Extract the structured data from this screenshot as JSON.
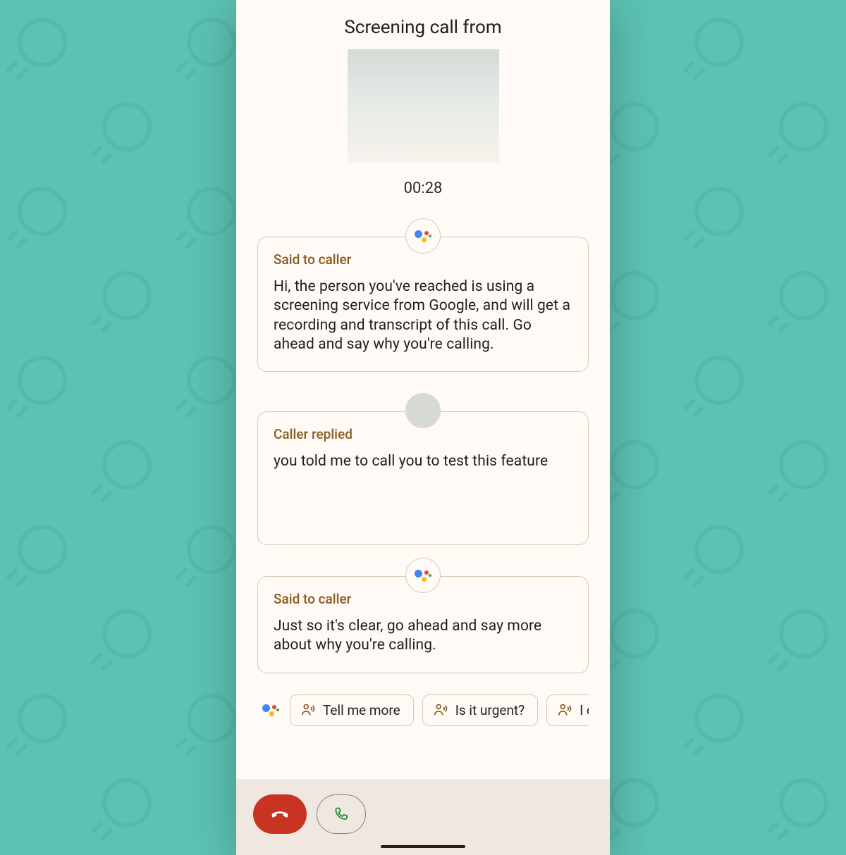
{
  "header": {
    "title": "Screening call from",
    "timer": "00:28"
  },
  "messages": [
    {
      "label": "Said to caller",
      "body": "Hi, the person you've reached is using a screening service from Google, and will get a recording and transcript of this call. Go ahead and say why you're calling."
    },
    {
      "label": "Caller replied",
      "body": "you told me to call you to test this feature"
    },
    {
      "label": "Said to caller",
      "body": "Just so it's clear, go ahead and say more about why you're calling."
    }
  ],
  "replies": [
    {
      "label": "Tell me more"
    },
    {
      "label": "Is it urgent?"
    },
    {
      "label": "I can't"
    }
  ],
  "actions": {
    "hangup": "End call",
    "answer": "Answer"
  }
}
